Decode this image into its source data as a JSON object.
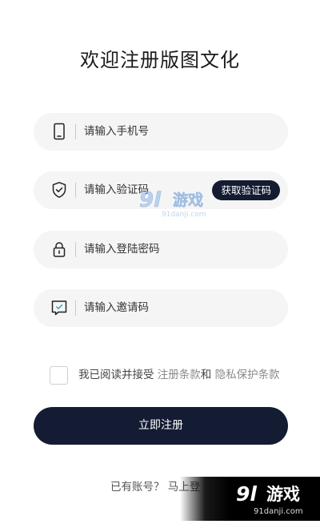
{
  "title": "欢迎注册版图文化",
  "fields": {
    "phone": {
      "placeholder": "请输入手机号",
      "icon": "phone-icon"
    },
    "code": {
      "placeholder": "请输入验证码",
      "icon": "shield-icon",
      "button_label": "获取验证码"
    },
    "password": {
      "placeholder": "请输入登陆密码",
      "icon": "lock-icon"
    },
    "invite": {
      "placeholder": "请输入邀请码",
      "icon": "invite-icon"
    }
  },
  "agreement": {
    "prefix": "我已阅读并接受",
    "terms_link": "注册条款",
    "conjunction": "和",
    "privacy_link": "隐私保护条款",
    "checked": false
  },
  "submit_label": "立即注册",
  "footer": {
    "prompt": "已有账号？",
    "login_link": "马上登"
  },
  "watermark": {
    "brand_number": "9l",
    "brand_text": "游戏",
    "domain": "91danji.com"
  },
  "colors": {
    "primary": "#141c33",
    "field_bg": "#f5f5f6",
    "text": "#333333",
    "link": "#8a8a8a"
  }
}
